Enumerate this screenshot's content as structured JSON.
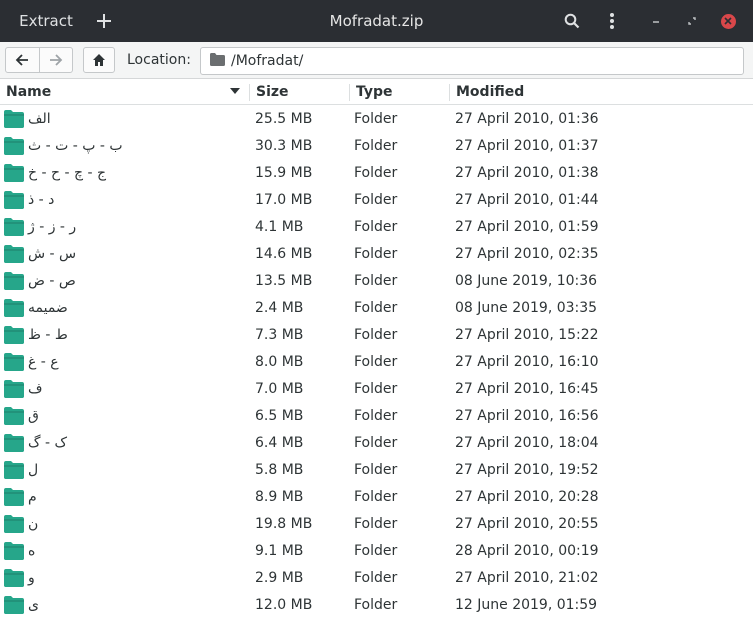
{
  "header": {
    "extract_label": "Extract",
    "plus_icon": "plus-icon",
    "title": "Mofradat.zip",
    "search_icon": "search-icon",
    "menu_icon": "kebab-menu-icon",
    "minimize_icon": "minimize-icon",
    "maximize_icon": "maximize-icon",
    "close_icon": "close-icon",
    "close_color": "#d9474a"
  },
  "locbar": {
    "back_icon": "arrow-left-icon",
    "forward_icon": "arrow-right-icon",
    "home_icon": "home-icon",
    "location_label": "Location:",
    "location_value": "/Mofradat/"
  },
  "columns": {
    "name": "Name",
    "size": "Size",
    "type": "Type",
    "modified": "Modified"
  },
  "folder_color": "#26a68a",
  "rows": [
    {
      "name": "الف",
      "size": "25.5 MB",
      "type": "Folder",
      "modified": "27 April 2010, 01:36"
    },
    {
      "name": "ب - پ - ت - ث",
      "size": "30.3 MB",
      "type": "Folder",
      "modified": "27 April 2010, 01:37"
    },
    {
      "name": "ج - چ - ح - خ",
      "size": "15.9 MB",
      "type": "Folder",
      "modified": "27 April 2010, 01:38"
    },
    {
      "name": "د - ذ",
      "size": "17.0 MB",
      "type": "Folder",
      "modified": "27 April 2010, 01:44"
    },
    {
      "name": "ر - ز - ژ",
      "size": "4.1 MB",
      "type": "Folder",
      "modified": "27 April 2010, 01:59"
    },
    {
      "name": "س - ش",
      "size": "14.6 MB",
      "type": "Folder",
      "modified": "27 April 2010, 02:35"
    },
    {
      "name": "ص - ض",
      "size": "13.5 MB",
      "type": "Folder",
      "modified": "08 June 2019, 10:36"
    },
    {
      "name": "ضمیمه",
      "size": "2.4 MB",
      "type": "Folder",
      "modified": "08 June 2019, 03:35"
    },
    {
      "name": "ط - ظ",
      "size": "7.3 MB",
      "type": "Folder",
      "modified": "27 April 2010, 15:22"
    },
    {
      "name": "ع - غ",
      "size": "8.0 MB",
      "type": "Folder",
      "modified": "27 April 2010, 16:10"
    },
    {
      "name": "ف",
      "size": "7.0 MB",
      "type": "Folder",
      "modified": "27 April 2010, 16:45"
    },
    {
      "name": "ق",
      "size": "6.5 MB",
      "type": "Folder",
      "modified": "27 April 2010, 16:56"
    },
    {
      "name": "ک - گ",
      "size": "6.4 MB",
      "type": "Folder",
      "modified": "27 April 2010, 18:04"
    },
    {
      "name": "ل",
      "size": "5.8 MB",
      "type": "Folder",
      "modified": "27 April 2010, 19:52"
    },
    {
      "name": "م",
      "size": "8.9 MB",
      "type": "Folder",
      "modified": "27 April 2010, 20:28"
    },
    {
      "name": "ن",
      "size": "19.8 MB",
      "type": "Folder",
      "modified": "27 April 2010, 20:55"
    },
    {
      "name": "ه",
      "size": "9.1 MB",
      "type": "Folder",
      "modified": "28 April 2010, 00:19"
    },
    {
      "name": "و",
      "size": "2.9 MB",
      "type": "Folder",
      "modified": "27 April 2010, 21:02"
    },
    {
      "name": "ی",
      "size": "12.0 MB",
      "type": "Folder",
      "modified": "12 June 2019, 01:59"
    }
  ]
}
